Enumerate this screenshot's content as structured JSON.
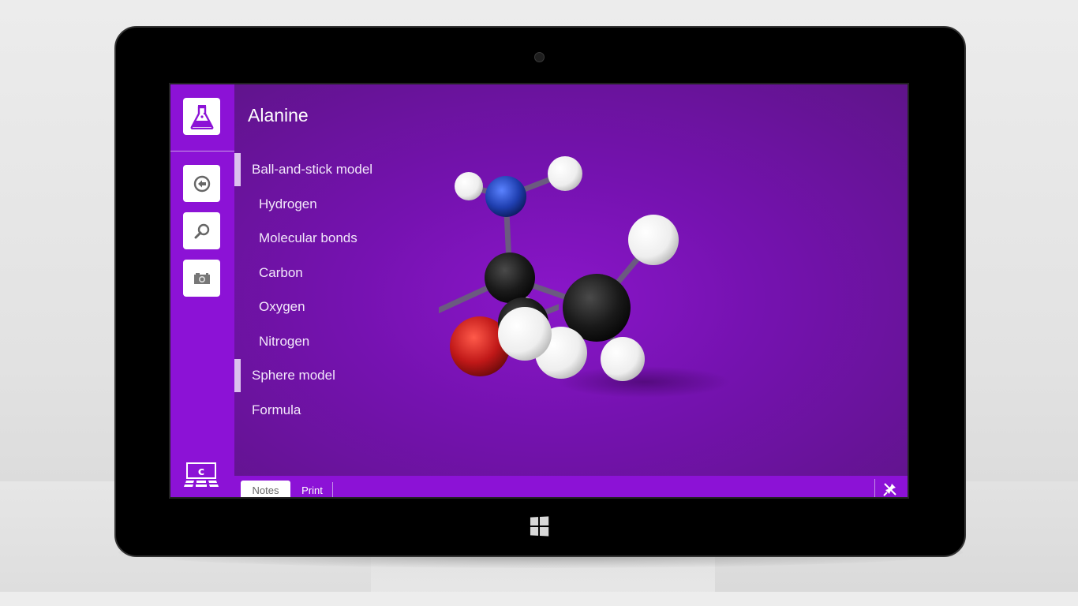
{
  "app": {
    "title": "Alanine",
    "accent_color": "#8c12d6",
    "background_color": "#6a13a0"
  },
  "sidebar": {
    "logo_icon": "flask-icon",
    "buttons": [
      {
        "name": "back",
        "icon": "back-arrow-circle-icon"
      },
      {
        "name": "search",
        "icon": "magnifier-icon"
      },
      {
        "name": "snapshot",
        "icon": "camera-icon"
      }
    ],
    "brand_icon": "computer-c-icon",
    "brand_letter": "c"
  },
  "nav": {
    "items": [
      {
        "label": "Ball-and-stick model",
        "level": "top",
        "selected": true
      },
      {
        "label": "Hydrogen",
        "level": "sub",
        "selected": false
      },
      {
        "label": "Molecular bonds",
        "level": "sub",
        "selected": false
      },
      {
        "label": "Carbon",
        "level": "sub",
        "selected": false
      },
      {
        "label": "Oxygen",
        "level": "sub",
        "selected": false
      },
      {
        "label": "Nitrogen",
        "level": "sub",
        "selected": false
      },
      {
        "label": "Sphere model",
        "level": "top",
        "selected": true
      },
      {
        "label": "Formula",
        "level": "top",
        "selected": false
      }
    ]
  },
  "molecule": {
    "name": "Alanine",
    "model": "ball-and-stick",
    "atom_colors": {
      "hydrogen": "#f2f2f2",
      "carbon": "#1a1a1a",
      "oxygen": "#c01818",
      "nitrogen": "#1f3fb0"
    }
  },
  "bottom_bar": {
    "tabs": [
      {
        "label": "Notes",
        "active": true
      },
      {
        "label": "Print",
        "active": false
      }
    ],
    "pin_icon": "unpin-icon"
  },
  "device": {
    "start_button_icon": "windows-logo-icon"
  }
}
